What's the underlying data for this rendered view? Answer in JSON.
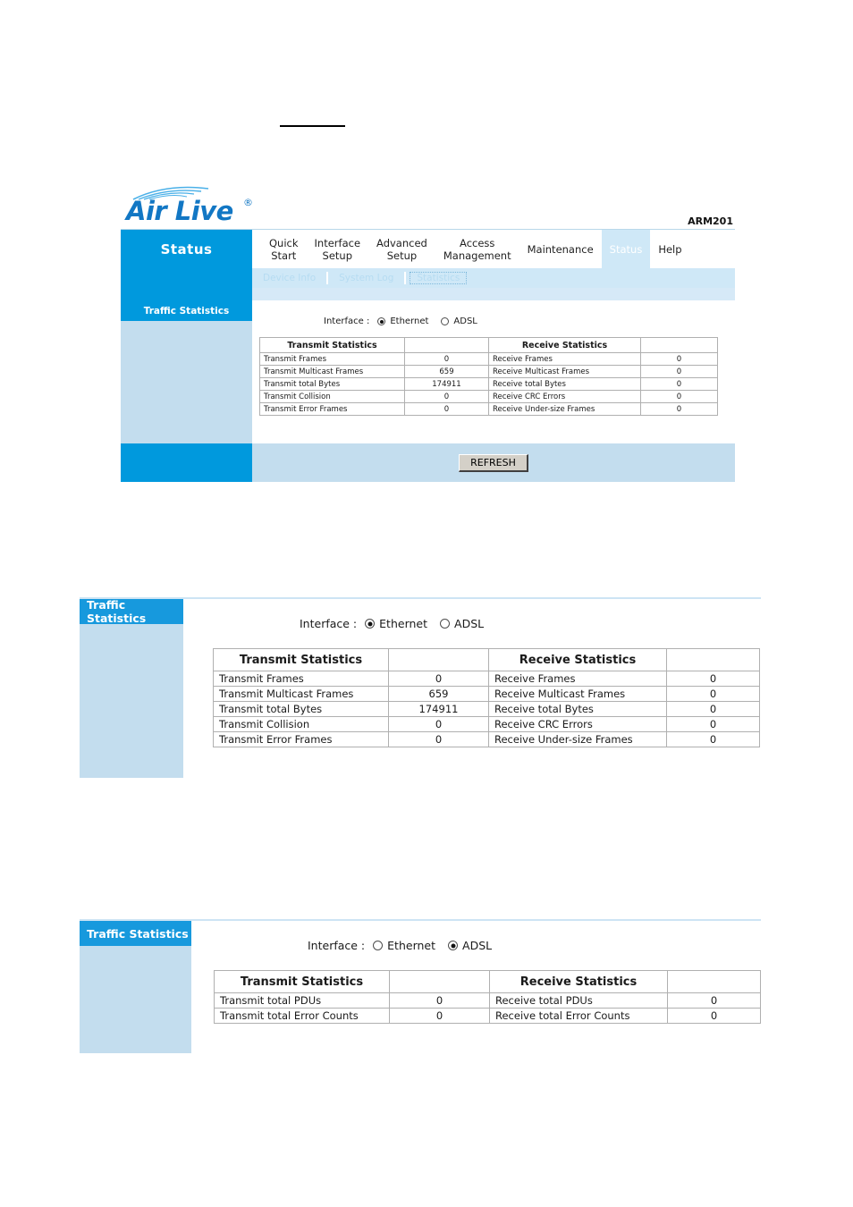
{
  "brand": {
    "logo_text": "Air Live",
    "logo_registered": "®",
    "model": "ARM201"
  },
  "nav": {
    "active_section": "Status",
    "tabs": [
      {
        "line1": "Quick",
        "line2": "Start",
        "active": false
      },
      {
        "line1": "Interface",
        "line2": "Setup",
        "active": false
      },
      {
        "line1": "Advanced",
        "line2": "Setup",
        "active": false
      },
      {
        "line1": "Access",
        "line2": "Management",
        "active": false
      },
      {
        "line1": "Maintenance",
        "line2": "",
        "active": false
      },
      {
        "line1": "Status",
        "line2": "",
        "active": true
      },
      {
        "line1": "Help",
        "line2": "",
        "active": false
      }
    ],
    "subnav": [
      {
        "label": "Device Info",
        "focused": false
      },
      {
        "label": "System Log",
        "focused": false
      },
      {
        "label": "Statistics",
        "focused": true
      }
    ]
  },
  "sidebar": {
    "title": "Traffic Statistics"
  },
  "buttons": {
    "refresh": "REFRESH"
  },
  "interface": {
    "label": "Interface :",
    "options": [
      "Ethernet",
      "ADSL"
    ],
    "selected_ethernet": "Ethernet",
    "selected_adsl": "ADSL"
  },
  "table_headers": {
    "transmit": "Transmit Statistics",
    "receive": "Receive Statistics",
    "blank": ""
  },
  "ethernet_stats": {
    "rows": [
      {
        "tx_label": "Transmit Frames",
        "tx_value": "0",
        "rx_label": "Receive Frames",
        "rx_value": "0"
      },
      {
        "tx_label": "Transmit Multicast Frames",
        "tx_value": "659",
        "rx_label": "Receive Multicast Frames",
        "rx_value": "0"
      },
      {
        "tx_label": "Transmit total Bytes",
        "tx_value": "174911",
        "rx_label": "Receive total Bytes",
        "rx_value": "0"
      },
      {
        "tx_label": "Transmit Collision",
        "tx_value": "0",
        "rx_label": "Receive CRC Errors",
        "rx_value": "0"
      },
      {
        "tx_label": "Transmit Error Frames",
        "tx_value": "0",
        "rx_label": "Receive Under-size Frames",
        "rx_value": "0"
      }
    ]
  },
  "adsl_stats": {
    "rows": [
      {
        "tx_label": "Transmit total PDUs",
        "tx_value": "0",
        "rx_label": "Receive total PDUs",
        "rx_value": "0"
      },
      {
        "tx_label": "Transmit total Error Counts",
        "tx_value": "0",
        "rx_label": "Receive total Error Counts",
        "rx_value": "0"
      }
    ]
  },
  "colors": {
    "brand_blue": "#0099dd",
    "panel_blue": "#c3ddee",
    "subnav_blue": "#cfe8f7",
    "logo_blue": "#1277c4"
  }
}
